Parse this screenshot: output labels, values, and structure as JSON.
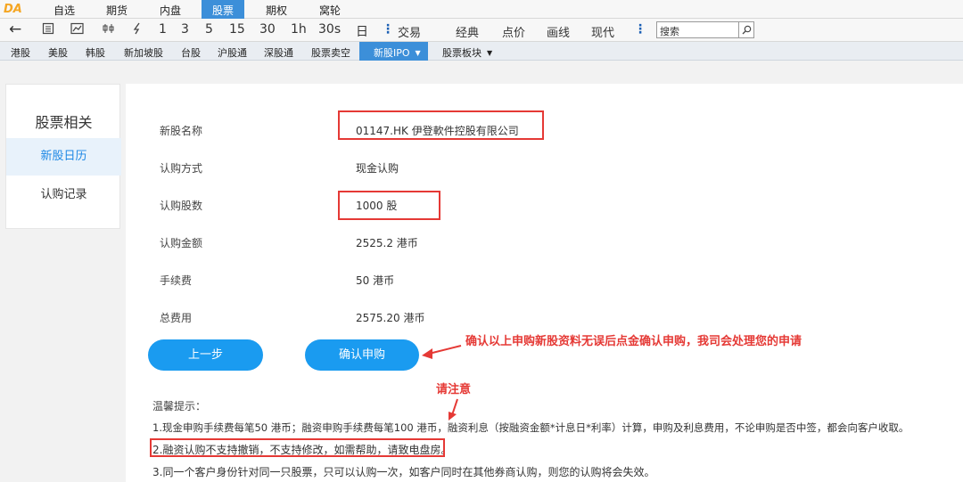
{
  "app": {
    "logo": "DA"
  },
  "menu": {
    "items": [
      "自选",
      "期货",
      "内盘",
      "股票",
      "期权",
      "窝轮"
    ],
    "active": "股票"
  },
  "toolbar": {
    "back_icon": "←",
    "periods": [
      "1",
      "3",
      "5",
      "15",
      "30",
      "1h",
      "30s",
      "日"
    ],
    "more_icon": "⋮",
    "modes": [
      "交易",
      "经典",
      "点价",
      "画线",
      "现代"
    ],
    "search_placeholder": "搜索"
  },
  "nav": {
    "items": [
      "港股",
      "美股",
      "韩股",
      "新加坡股",
      "台股",
      "沪股通",
      "深股通",
      "股票卖空"
    ],
    "active": "新股IPO",
    "dropdown": "股票板块"
  },
  "sidebar": {
    "title": "股票相关",
    "items": [
      {
        "label": "新股日历",
        "active": true
      },
      {
        "label": "认购记录",
        "active": false
      }
    ]
  },
  "form": {
    "rows": [
      {
        "label": "新股名称",
        "value": "01147.HK 伊登軟件控股有限公司"
      },
      {
        "label": "认购方式",
        "value": "现金认购"
      },
      {
        "label": "认购股数",
        "value": "1000 股"
      },
      {
        "label": "认购金额",
        "value": "2525.2 港币"
      },
      {
        "label": "手续费",
        "value": "50 港币"
      },
      {
        "label": "总费用",
        "value": "2575.20 港币"
      }
    ]
  },
  "buttons": {
    "prev": "上一步",
    "confirm": "确认申购"
  },
  "annotations": {
    "confirm_note": "确认以上申购新股资料无误后点金确认申购，我司会处理您的申请",
    "attention": "请注意"
  },
  "tips": {
    "title": "温馨提示：",
    "items": [
      "1.现金申购手续费每笔50 港币；融资申购手续费每笔100 港币，融资利息（按融资金额*计息日*利率）计算，申购及利息费用，不论申购是否中签，都会向客户收取。",
      "2.融资认购不支持撤销，不支持修改，如需帮助，请致电盘房。",
      "3.同一个客户身份针对同一只股票，只可以认购一次，如客户同时在其他券商认购，则您的认购将会失效。"
    ]
  },
  "colors": {
    "accent": "#1a9bf0",
    "highlight": "#e53935",
    "active_tab": "#3c8fd9"
  }
}
